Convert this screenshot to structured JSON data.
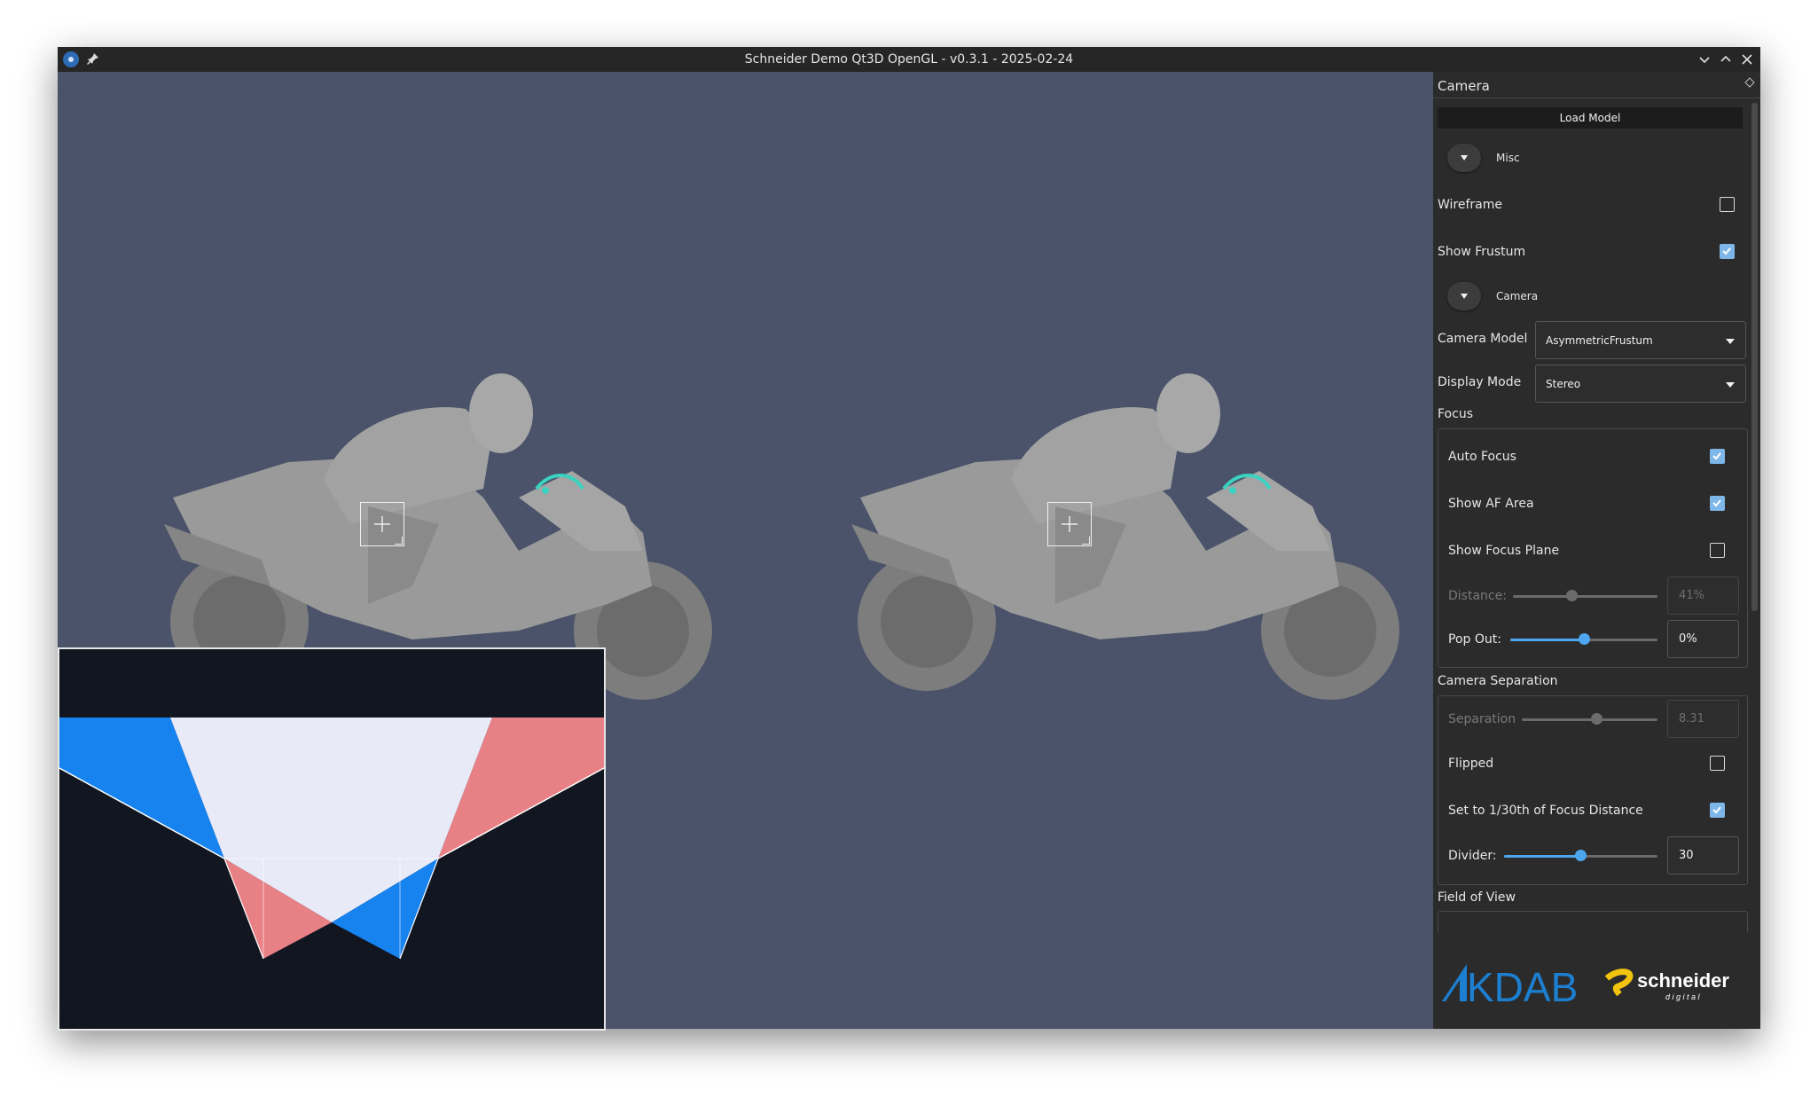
{
  "window": {
    "title": "Schneider Demo Qt3D OpenGL - v0.3.1 - 2025-02-24",
    "icons": [
      "app-icon",
      "pin-icon",
      "minimize-icon",
      "maximize-icon",
      "close-icon"
    ]
  },
  "panel": {
    "title": "Camera",
    "load_model_label": "Load Model",
    "misc_section": {
      "label": "Misc",
      "wireframe_label": "Wireframe",
      "wireframe_checked": false,
      "show_frustum_label": "Show Frustum",
      "show_frustum_checked": true
    },
    "camera_section": {
      "label": "Camera",
      "camera_model_label": "Camera Model",
      "camera_model_value": "AsymmetricFrustum",
      "display_mode_label": "Display Mode",
      "display_mode_value": "Stereo"
    },
    "focus": {
      "label": "Focus",
      "auto_focus_label": "Auto Focus",
      "auto_focus_checked": true,
      "show_af_area_label": "Show AF Area",
      "show_af_area_checked": true,
      "show_focus_plane_label": "Show Focus Plane",
      "show_focus_plane_checked": false,
      "distance_label": "Distance:",
      "distance_value": "41%",
      "distance_fraction": 0.41,
      "pop_out_label": "Pop Out:",
      "pop_out_value": "0%",
      "pop_out_fraction": 0.5
    },
    "camera_separation": {
      "label": "Camera Separation",
      "separation_label": "Separation",
      "separation_value": "8.31",
      "separation_fraction": 0.55,
      "flipped_label": "Flipped",
      "flipped_checked": false,
      "set_to_label": "Set to 1/30th of Focus Distance",
      "set_to_checked": true,
      "divider_label": "Divider:",
      "divider_value": "30",
      "divider_fraction": 0.5
    },
    "field_of_view": {
      "label": "Field of View"
    },
    "logos": {
      "kdab": "KDAB",
      "schneider": "schneider",
      "schneider_sub": "d i g i t a l"
    }
  },
  "colors": {
    "viewport_bg": "#4a5369",
    "panel_bg": "#2b2b2b",
    "accent": "#4ea6ee",
    "frustum_blue": "#1683ef",
    "frustum_red": "#e88185",
    "frustum_white": "#e8eaf8"
  }
}
